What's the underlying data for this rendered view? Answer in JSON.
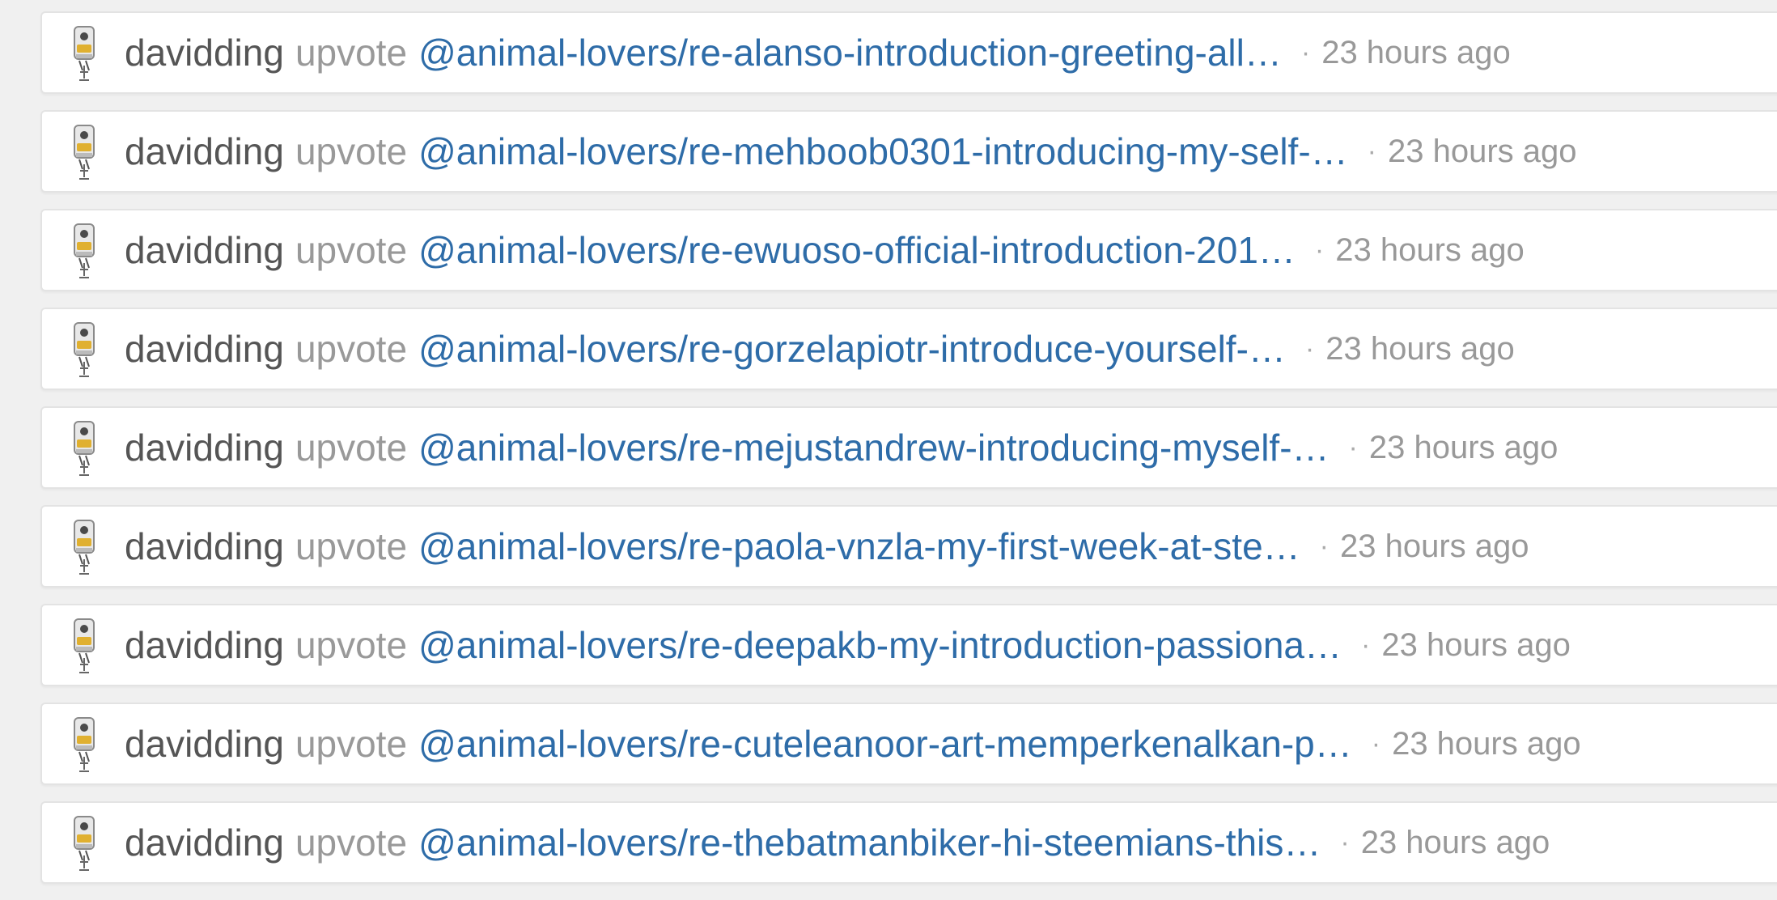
{
  "feed": {
    "items": [
      {
        "author": "davidding",
        "action": "upvote",
        "permlink": "@animal-lovers/re-alanso-introduction-greeting-all…",
        "sep": "·",
        "time": "23 hours ago"
      },
      {
        "author": "davidding",
        "action": "upvote",
        "permlink": "@animal-lovers/re-mehboob0301-introducing-my-self-…",
        "sep": "·",
        "time": "23 hours ago"
      },
      {
        "author": "davidding",
        "action": "upvote",
        "permlink": "@animal-lovers/re-ewuoso-official-introduction-201…",
        "sep": "·",
        "time": "23 hours ago"
      },
      {
        "author": "davidding",
        "action": "upvote",
        "permlink": "@animal-lovers/re-gorzelapiotr-introduce-yourself-…",
        "sep": "·",
        "time": "23 hours ago"
      },
      {
        "author": "davidding",
        "action": "upvote",
        "permlink": "@animal-lovers/re-mejustandrew-introducing-myself-…",
        "sep": "·",
        "time": "23 hours ago"
      },
      {
        "author": "davidding",
        "action": "upvote",
        "permlink": "@animal-lovers/re-paola-vnzla-my-first-week-at-ste…",
        "sep": "·",
        "time": "23 hours ago"
      },
      {
        "author": "davidding",
        "action": "upvote",
        "permlink": "@animal-lovers/re-deepakb-my-introduction-passiona…",
        "sep": "·",
        "time": "23 hours ago"
      },
      {
        "author": "davidding",
        "action": "upvote",
        "permlink": "@animal-lovers/re-cuteleanoor-art-memperkenalkan-p…",
        "sep": "·",
        "time": "23 hours ago"
      },
      {
        "author": "davidding",
        "action": "upvote",
        "permlink": "@animal-lovers/re-thebatmanbiker-hi-steemians-this…",
        "sep": "·",
        "time": "23 hours ago"
      }
    ]
  },
  "colors": {
    "author": "#555555",
    "action": "#999999",
    "link": "#2e6ca8",
    "background": "#f0f0f0"
  },
  "icons": {
    "avatar": "robot-avatar-icon"
  }
}
